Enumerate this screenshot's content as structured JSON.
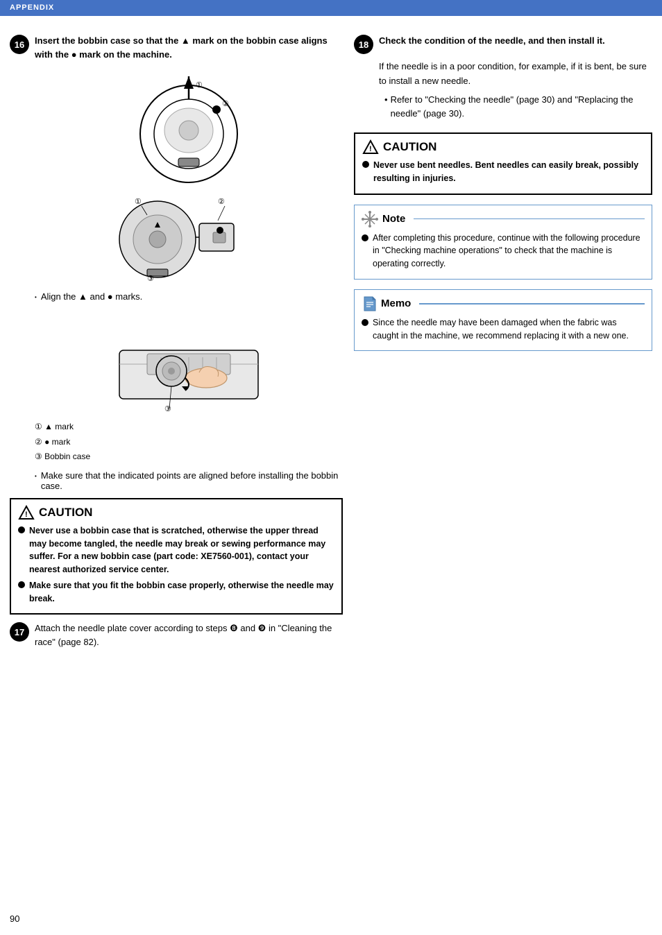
{
  "header": {
    "label": "APPENDIX"
  },
  "page_number": "90",
  "left_col": {
    "step16": {
      "number": "16",
      "text_bold": "Insert the bobbin case so that the ▲ mark on the bobbin case aligns with the ● mark on the machine.",
      "bullet1": "Align the ▲ and ● marks.",
      "legend": [
        "① ▲ mark",
        "② ● mark",
        "③ Bobbin case"
      ],
      "bullet2": "Make sure that the indicated points are aligned before installing the bobbin case."
    },
    "caution1": {
      "title": "CAUTION",
      "items": [
        "Never use a bobbin case that is scratched, otherwise the upper thread may become tangled, the needle may break or sewing performance may suffer. For a new bobbin case (part code: XE7560-001), contact your nearest authorized service center.",
        "Make sure that you fit the bobbin case properly, otherwise the needle may break."
      ]
    },
    "step17": {
      "number": "17",
      "text": "Attach the needle plate cover according to steps ❽ and ❾ in \"Cleaning the race\" (page 82)."
    }
  },
  "right_col": {
    "step18": {
      "number": "18",
      "text_bold": "Check the condition of the needle, and then install it.",
      "body": "If the needle is in a poor condition, for example, if it is bent, be sure to install a new needle.",
      "ref": "Refer to \"Checking the needle\" (page 30) and \"Replacing the needle\" (page 30)."
    },
    "caution2": {
      "title": "CAUTION",
      "items": [
        "Never use bent needles. Bent needles can easily break, possibly resulting in injuries."
      ]
    },
    "note": {
      "title": "Note",
      "items": [
        "After completing this procedure, continue with the following procedure in \"Checking machine operations\" to check that the machine is operating correctly."
      ]
    },
    "memo": {
      "title": "Memo",
      "items": [
        "Since the needle may have been damaged when the fabric was caught in the machine, we recommend replacing it with a new one."
      ]
    }
  }
}
